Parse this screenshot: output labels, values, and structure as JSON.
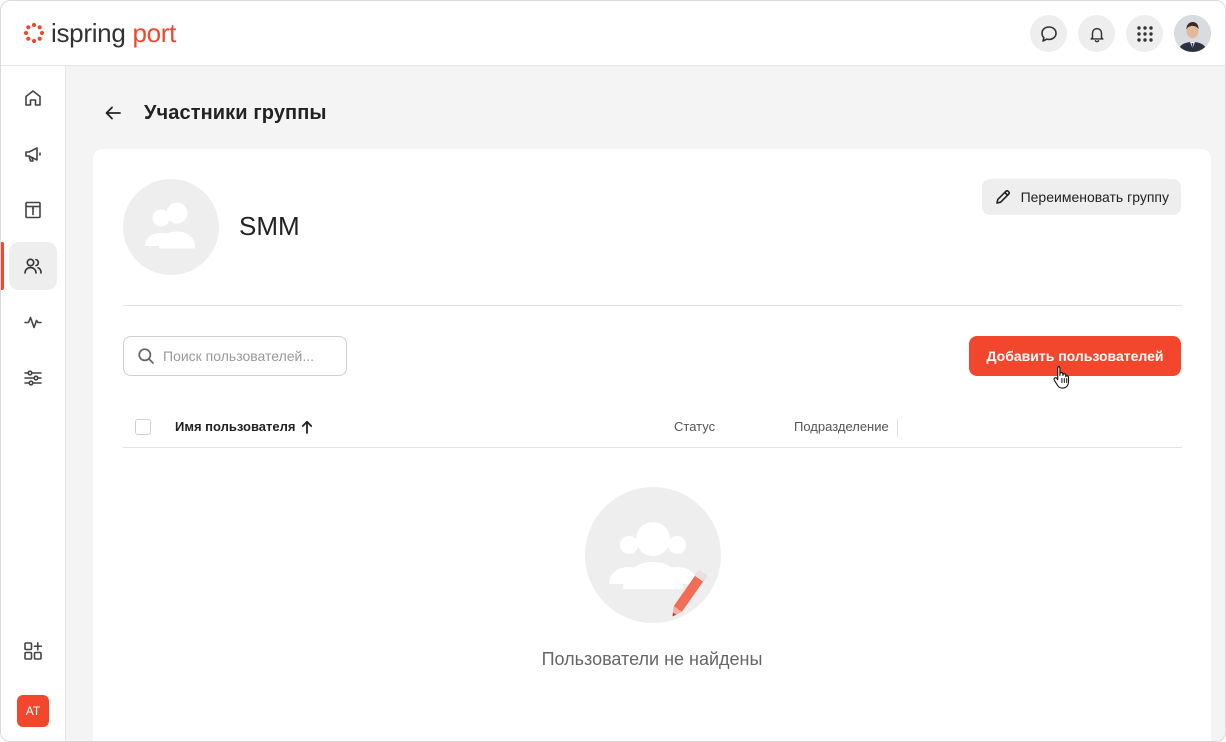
{
  "app": {
    "logo_word1": "ispring",
    "logo_word2": "port",
    "brand_color": "#f2472c"
  },
  "topbar": {
    "icons": [
      "chat-icon",
      "bell-icon",
      "apps-grid-icon"
    ],
    "user_avatar": "user-photo"
  },
  "sidebar": {
    "items": [
      {
        "icon": "home-icon",
        "active": false
      },
      {
        "icon": "megaphone-icon",
        "active": false
      },
      {
        "icon": "info-board-icon",
        "active": false
      },
      {
        "icon": "users-icon",
        "active": true
      },
      {
        "icon": "activity-icon",
        "active": false
      },
      {
        "icon": "sliders-icon",
        "active": false
      }
    ],
    "bottom_icon": "add-widget-icon",
    "user_initials": "AT"
  },
  "page": {
    "title": "Участники группы"
  },
  "group": {
    "name": "SMM",
    "rename_label": "Переименовать группу"
  },
  "search": {
    "placeholder": "Поиск пользователей...",
    "value": ""
  },
  "actions": {
    "add_users_label": "Добавить пользователей"
  },
  "table": {
    "columns": {
      "name": "Имя пользователя",
      "status": "Статус",
      "department": "Подразделение"
    },
    "sort": {
      "column": "name",
      "direction": "asc"
    },
    "rows": []
  },
  "empty_state": {
    "text": "Пользователи не найдены"
  }
}
